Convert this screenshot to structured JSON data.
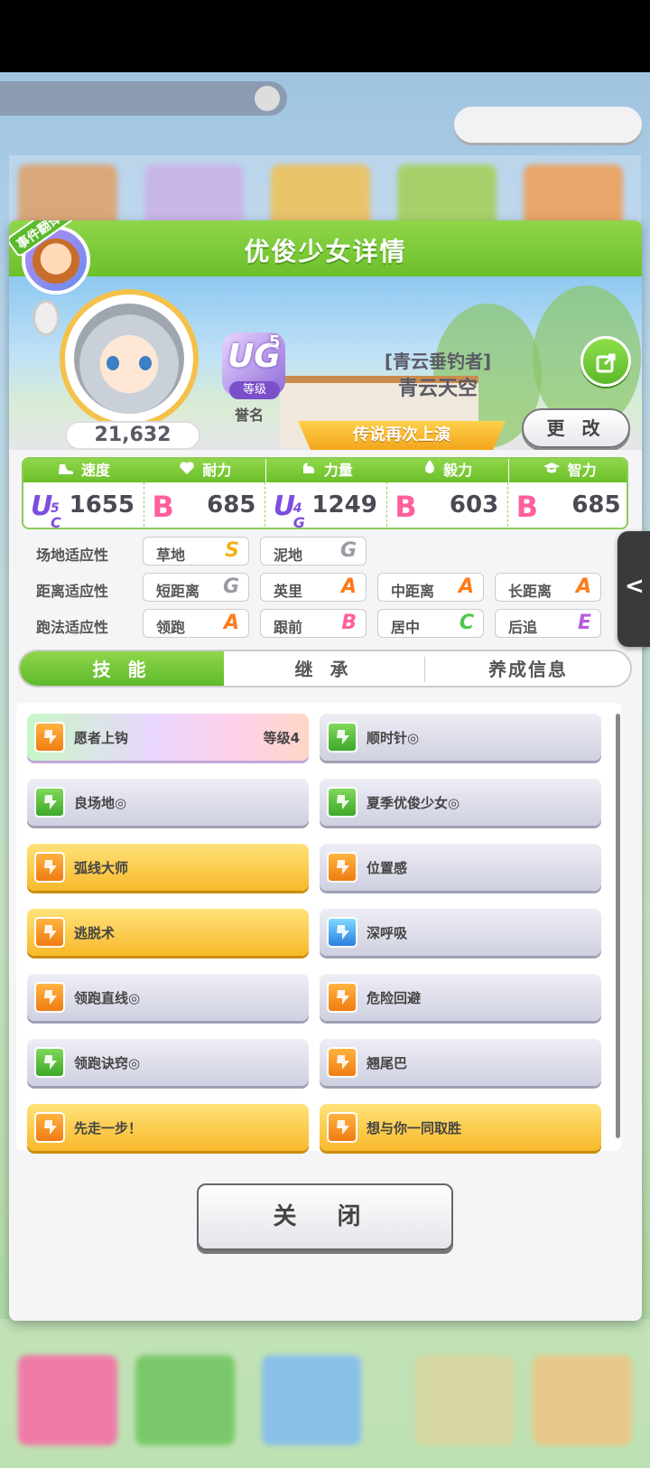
{
  "modal": {
    "title": "优俊少女详情",
    "translator_badge": "事件翻译器"
  },
  "profile": {
    "score": "21,632",
    "rank_letters": "UG",
    "rank_num": "5",
    "rank_tag": "等级",
    "fame_label": "誉名",
    "epithet": "[青云垂钓者]",
    "name": "青云天空",
    "title_banner": "传说再次上演",
    "change_label": "更 改",
    "title_value": "-"
  },
  "stats": [
    {
      "label": "速度",
      "grade": "UC",
      "grade_num": "5",
      "value": "1655",
      "icon": "shoe-icon"
    },
    {
      "label": "耐力",
      "grade": "B",
      "value": "685",
      "icon": "heart-icon"
    },
    {
      "label": "力量",
      "grade": "UG",
      "grade_num": "4",
      "value": "1249",
      "icon": "muscle-icon"
    },
    {
      "label": "毅力",
      "grade": "B",
      "value": "603",
      "icon": "flame-icon"
    },
    {
      "label": "智力",
      "grade": "B",
      "value": "685",
      "icon": "cap-icon"
    }
  ],
  "aptitude": {
    "track_label": "场地适应性",
    "distance_label": "距离适应性",
    "style_label": "跑法适应性",
    "track": [
      {
        "name": "草地",
        "grade": "S"
      },
      {
        "name": "泥地",
        "grade": "G"
      }
    ],
    "distance": [
      {
        "name": "短距离",
        "grade": "G"
      },
      {
        "name": "英里",
        "grade": "A"
      },
      {
        "name": "中距离",
        "grade": "A"
      },
      {
        "name": "长距离",
        "grade": "A"
      }
    ],
    "style": [
      {
        "name": "领跑",
        "grade": "A"
      },
      {
        "name": "跟前",
        "grade": "B"
      },
      {
        "name": "居中",
        "grade": "C"
      },
      {
        "name": "后追",
        "grade": "E"
      }
    ]
  },
  "grade_colors": {
    "S": "#f2b21c",
    "A": "#ff7a1a",
    "B": "#ff5f9c",
    "C": "#49c84c",
    "E": "#b65ce0",
    "G": "#9a9aa6"
  },
  "tabs": [
    "技 能",
    "继 承",
    "养成信息"
  ],
  "skills": [
    {
      "name": "愿者上钩",
      "level": "等级4",
      "style": "rainbow",
      "icon": "orange"
    },
    {
      "name": "顺时针◎",
      "style": "silver",
      "icon": "green"
    },
    {
      "name": "良场地◎",
      "style": "silver",
      "icon": "green"
    },
    {
      "name": "夏季优俊少女◎",
      "style": "silver",
      "icon": "green"
    },
    {
      "name": "弧线大师",
      "style": "gold",
      "icon": "orange"
    },
    {
      "name": "位置感",
      "style": "silver",
      "icon": "orange"
    },
    {
      "name": "逃脱术",
      "style": "gold",
      "icon": "orange"
    },
    {
      "name": "深呼吸",
      "style": "silver",
      "icon": "blue"
    },
    {
      "name": "领跑直线◎",
      "style": "silver",
      "icon": "orange"
    },
    {
      "name": "危险回避",
      "style": "silver",
      "icon": "orange"
    },
    {
      "name": "领跑诀窍◎",
      "style": "silver",
      "icon": "green"
    },
    {
      "name": "翘尾巴",
      "style": "silver",
      "icon": "orange"
    },
    {
      "name": "先走一步！",
      "style": "gold",
      "icon": "orange"
    },
    {
      "name": "想与你一同取胜",
      "style": "gold",
      "icon": "orange"
    }
  ],
  "close_label": "关 闭"
}
